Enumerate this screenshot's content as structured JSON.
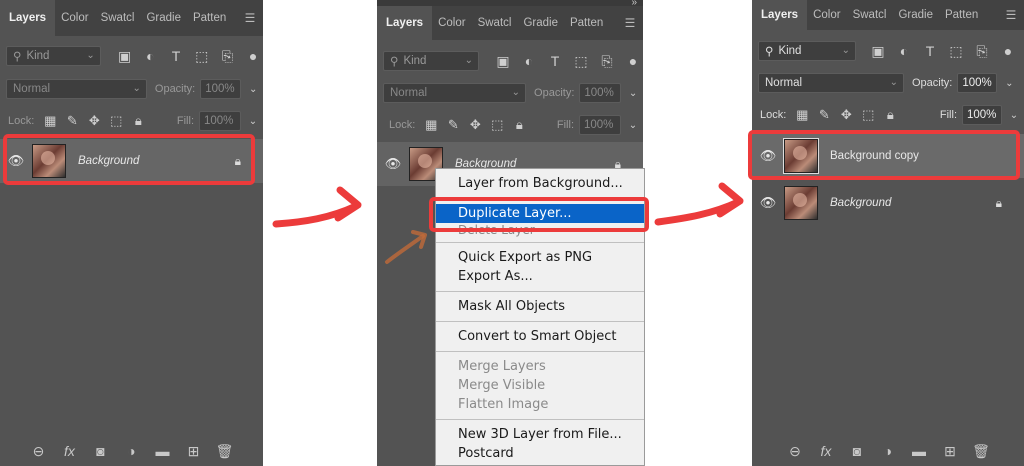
{
  "tabs": {
    "layers": "Layers",
    "color": "Color",
    "swatches": "Swatcl",
    "gradients": "Gradie",
    "patterns": "Patten"
  },
  "kind_label": "Kind",
  "blend_mode": "Normal",
  "opacity_label": "Opacity:",
  "fill_label": "Fill:",
  "lock_label": "Lock:",
  "opacity_value_dim": "100%",
  "opacity_value": "100%",
  "layers": {
    "background": "Background",
    "background_copy": "Background copy"
  },
  "context_menu": {
    "layer_from_background": "Layer from Background...",
    "duplicate_layer": "Duplicate Layer...",
    "delete_layer": "Delete Layer",
    "quick_export": "Quick Export as PNG",
    "export_as": "Export As...",
    "mask_all": "Mask All Objects",
    "convert_smart": "Convert to Smart Object",
    "merge_layers": "Merge Layers",
    "merge_visible": "Merge Visible",
    "flatten_image": "Flatten Image",
    "new_3d": "New 3D Layer from File...",
    "postcard": "Postcard"
  },
  "colors": {
    "panel": "#535353",
    "tabbar": "#424242",
    "highlight": "#ec3b3b",
    "menu_selected": "#0a64c8"
  },
  "icons": [
    "eye-icon",
    "lock-icon",
    "link-icon",
    "fx-icon",
    "mask-icon",
    "adjustment-icon",
    "folder-icon",
    "new-layer-icon",
    "trash-icon",
    "panel-menu-icon",
    "search-icon"
  ]
}
